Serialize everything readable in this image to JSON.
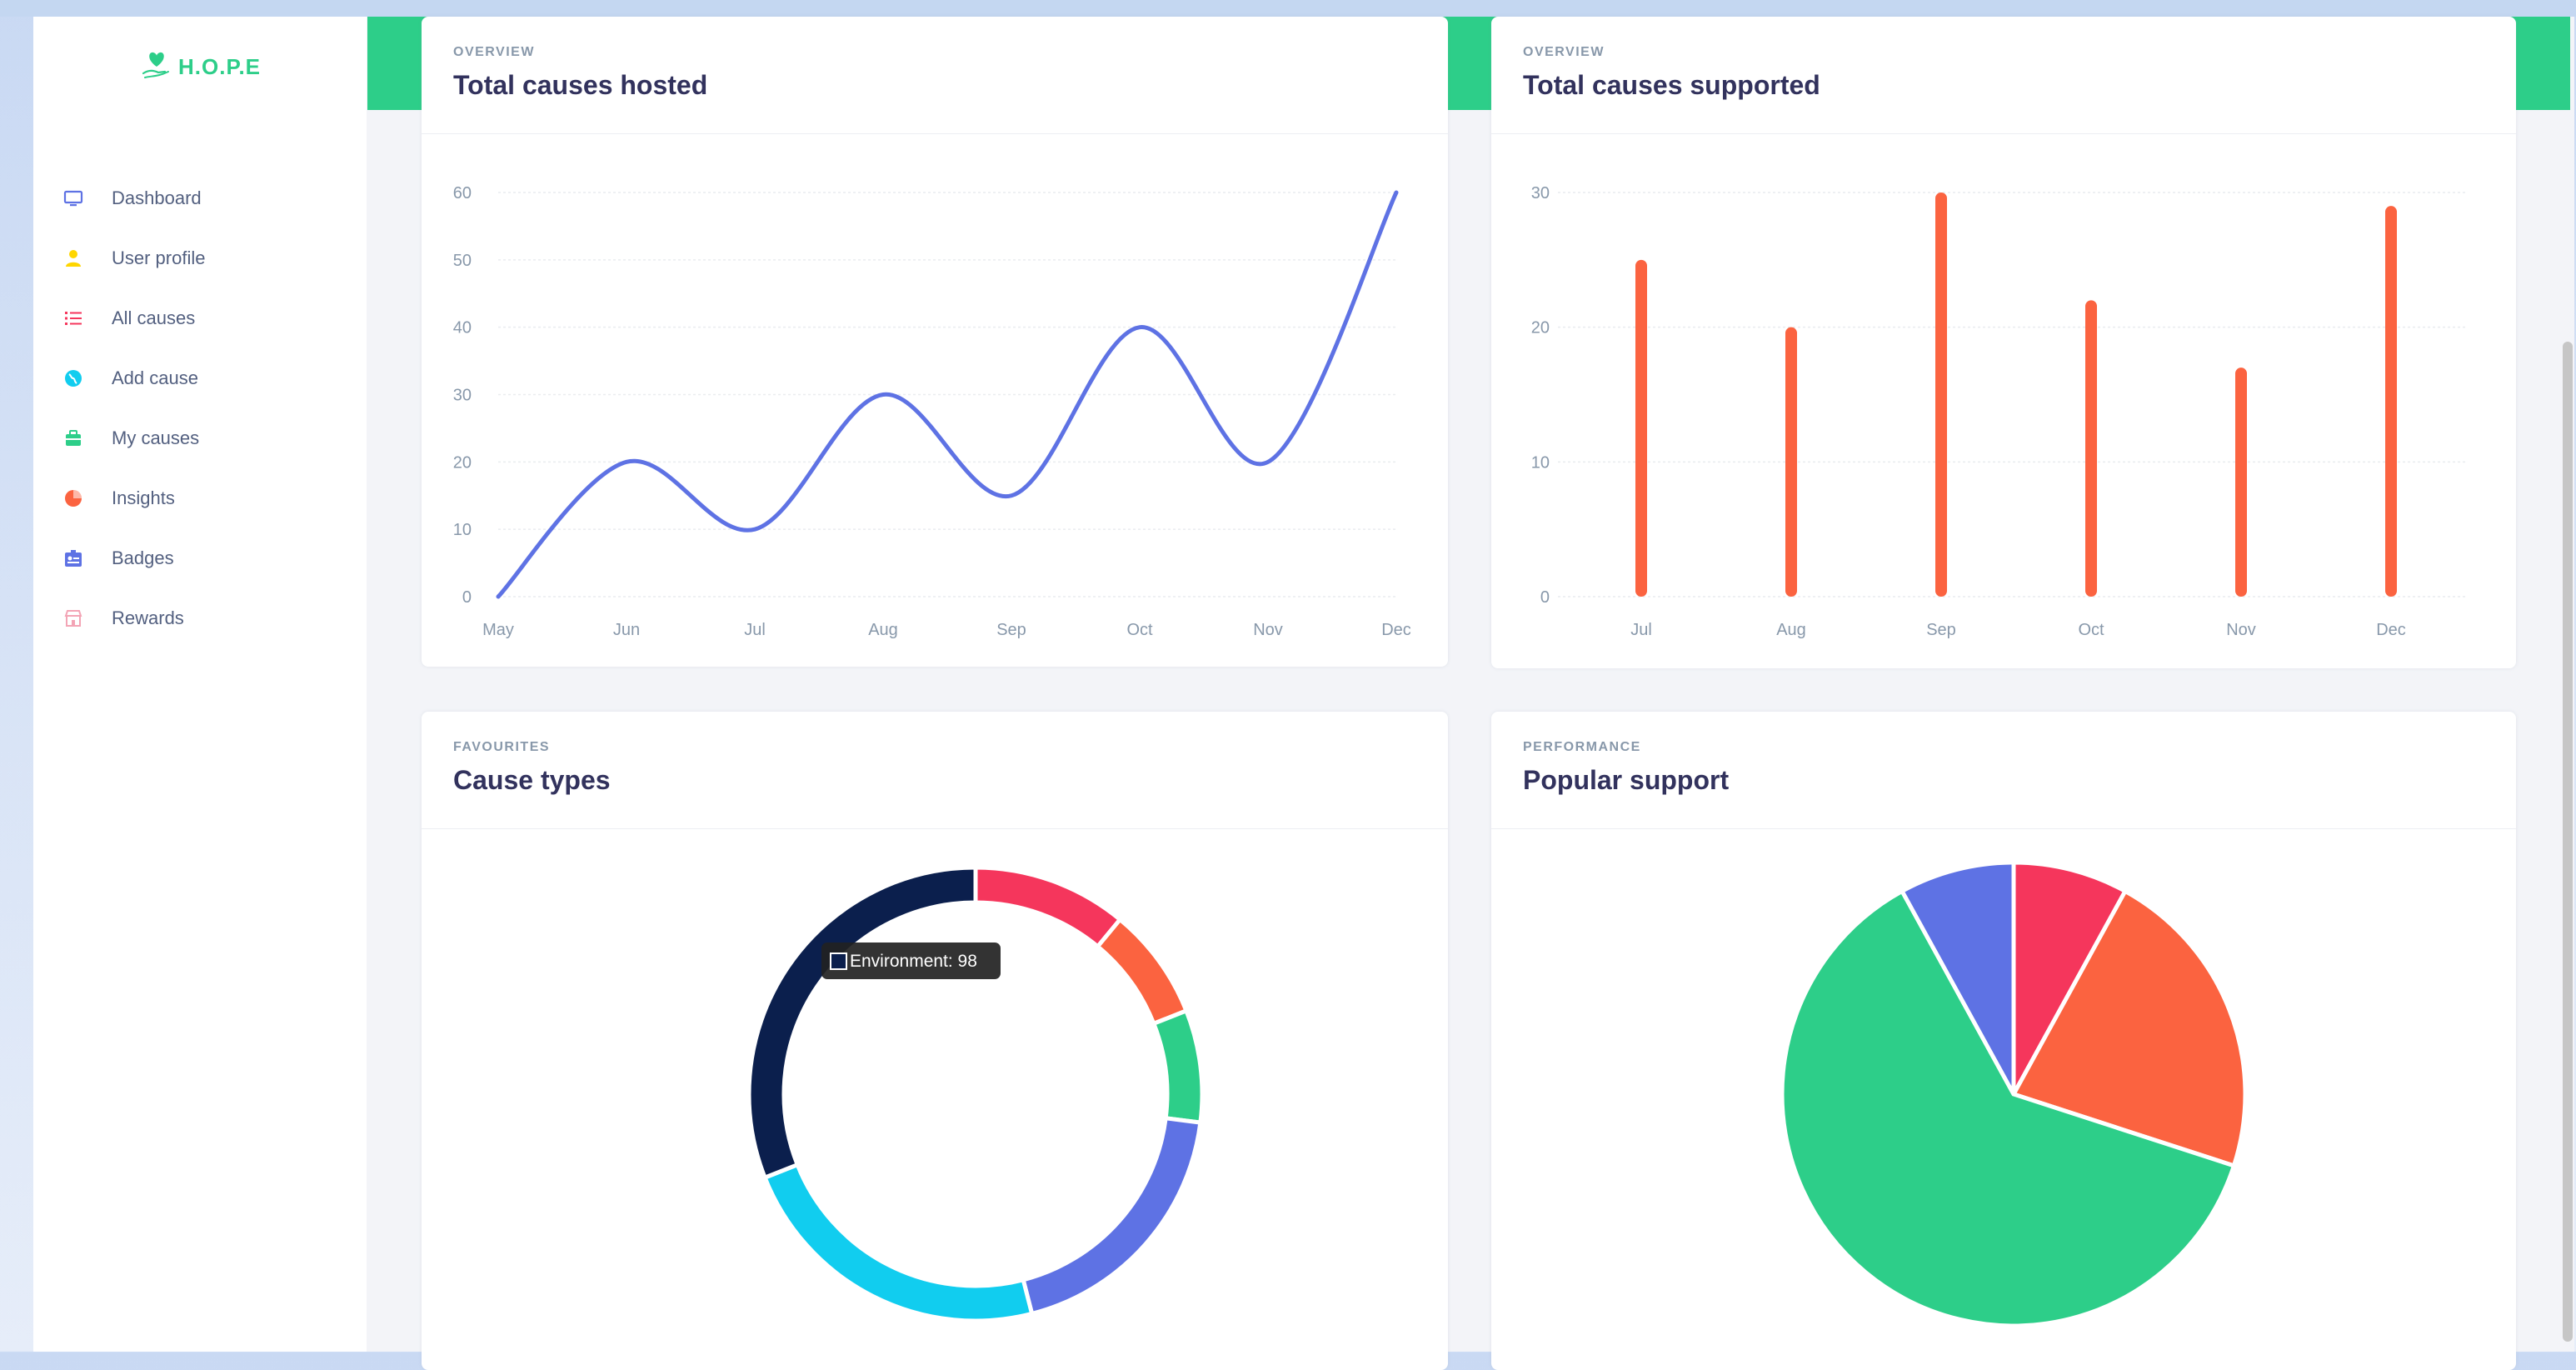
{
  "app": {
    "logo_text": "H.O.P.E"
  },
  "sidebar": {
    "items": [
      {
        "label": "Dashboard",
        "icon": "monitor-icon",
        "color": "#5e72e4"
      },
      {
        "label": "User profile",
        "icon": "user-icon",
        "color": "#ffd600"
      },
      {
        "label": "All causes",
        "icon": "list-icon",
        "color": "#f5365c"
      },
      {
        "label": "Add cause",
        "icon": "globe-icon",
        "color": "#11cdef"
      },
      {
        "label": "My causes",
        "icon": "briefcase-icon",
        "color": "#2dce89"
      },
      {
        "label": "Insights",
        "icon": "pie-chart-icon",
        "color": "#fb6340"
      },
      {
        "label": "Badges",
        "icon": "badge-icon",
        "color": "#5e72e4"
      },
      {
        "label": "Rewards",
        "icon": "shop-icon",
        "color": "#f3a4b5"
      }
    ]
  },
  "colors": {
    "accent_green": "#2dce89",
    "line_blue": "#5e72e4",
    "bar_orange": "#fb6340",
    "heading": "#32325d",
    "muted": "#8898aa"
  },
  "cards": {
    "hosted": {
      "kicker": "OVERVIEW",
      "title": "Total causes hosted"
    },
    "supported": {
      "kicker": "OVERVIEW",
      "title": "Total causes supported"
    },
    "types": {
      "kicker": "FAVOURITES",
      "title": "Cause types",
      "tooltip": "Environment: 98"
    },
    "popular": {
      "kicker": "PERFORMANCE",
      "title": "Popular support"
    }
  },
  "chart_data": [
    {
      "type": "line",
      "categories": [
        "May",
        "Jun",
        "Jul",
        "Aug",
        "Sep",
        "Oct",
        "Nov",
        "Dec"
      ],
      "values": [
        0,
        20,
        10,
        30,
        15,
        40,
        20,
        60
      ],
      "ylim": [
        0,
        60
      ],
      "yticks": [
        "0",
        "10",
        "20",
        "30",
        "40",
        "50",
        "60"
      ],
      "color": "#5e72e4",
      "grid": true
    },
    {
      "type": "bar",
      "categories": [
        "Jul",
        "Aug",
        "Sep",
        "Oct",
        "Nov",
        "Dec"
      ],
      "values": [
        25,
        20,
        30,
        22,
        17,
        29
      ],
      "ylim": [
        0,
        30
      ],
      "yticks": [
        "0",
        "10",
        "20",
        "30"
      ],
      "color": "#fb6340",
      "grid": true
    },
    {
      "type": "pie",
      "variant": "doughnut",
      "slices": [
        {
          "value": 11,
          "color": "#f5365c"
        },
        {
          "value": 8,
          "color": "#fb6340"
        },
        {
          "value": 8,
          "color": "#2dce89"
        },
        {
          "value": 19,
          "color": "#5e72e4"
        },
        {
          "value": 23,
          "color": "#11cdef"
        },
        {
          "value": 31,
          "name": "Environment",
          "color": "#0b1f4d"
        }
      ]
    },
    {
      "type": "pie",
      "slices": [
        {
          "value": 8,
          "color": "#f5365c"
        },
        {
          "value": 22,
          "color": "#fb6340"
        },
        {
          "value": 62,
          "color": "#2dce89"
        },
        {
          "value": 8,
          "color": "#5e72e4"
        }
      ]
    }
  ]
}
